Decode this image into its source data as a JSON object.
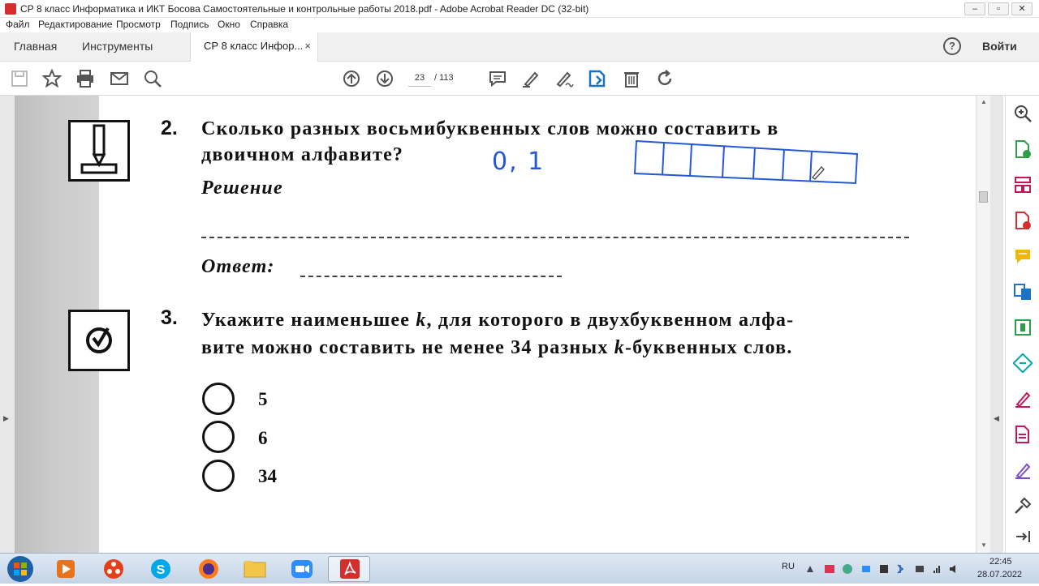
{
  "window": {
    "title": "СР 8 класс Информатика и ИКТ Босова Самостоятельные и контрольные работы 2018.pdf - Adobe Acrobat Reader DC (32-bit)",
    "minimize": "–",
    "maximize": "▫",
    "close": "✕"
  },
  "menu": [
    "Файл",
    "Редактирование",
    "Просмотр",
    "Подпись",
    "Окно",
    "Справка"
  ],
  "tabs": {
    "home": "Главная",
    "tools": "Инструменты",
    "document": "СР 8 класс Инфор...",
    "close": "×",
    "help": "?",
    "signin": "Войти"
  },
  "toolbar": {
    "page_current": "23",
    "page_total": "/  113",
    "icons": [
      "save-icon",
      "bookmark-star-icon",
      "print-icon",
      "email-icon",
      "search-icon",
      "page-up-icon",
      "page-down-icon",
      "comment-icon",
      "highlight-pen-icon",
      "sign-icon",
      "edit-pdf-icon",
      "delete-icon",
      "rotate-icon"
    ]
  },
  "document": {
    "q2": {
      "number": "2.",
      "line1": "Сколько  разных  восьмибуквенных  слов  можно  составить  в",
      "line2": "двоичном  алфавите?",
      "solution_label": "Решение",
      "answer_label": "Ответ:",
      "handwritten": "0, 1"
    },
    "q3": {
      "number": "3.",
      "line1_a": "Укажите  наименьшее ",
      "line1_k": "k",
      "line1_b": ",  для  которого  в  двухбуквенном  алфа-",
      "line2_a": "вите  можно  составить  не  менее  34  разных  ",
      "line2_k": "k",
      "line2_b": "-буквенных  слов.",
      "options": [
        "5",
        "6",
        "34"
      ]
    }
  },
  "right_pane": {
    "icons": [
      "zoom-icon",
      "export-pdf-icon",
      "organize-pages-icon",
      "create-pdf-icon",
      "comment-tool-icon",
      "combine-files-icon",
      "compress-icon",
      "edit-tool-icon",
      "fill-sign-icon",
      "send-for-review-icon",
      "protect-icon",
      "more-tools-icon",
      "collapse-pane-icon"
    ]
  },
  "taskbar": {
    "language": "RU",
    "time": "22:45",
    "date": "28.07.2022",
    "apps": [
      "start-button",
      "media-player-app",
      "app-launcher",
      "skype-app",
      "firefox-app",
      "file-explorer-app",
      "zoom-app",
      "acrobat-app"
    ]
  },
  "colors": {
    "acrobat_red": "#d32f2f",
    "tool_pink": "#c2185b",
    "tool_green": "#2e9e48",
    "tool_blue": "#1a73c7",
    "ink_blue": "#2458d6"
  }
}
